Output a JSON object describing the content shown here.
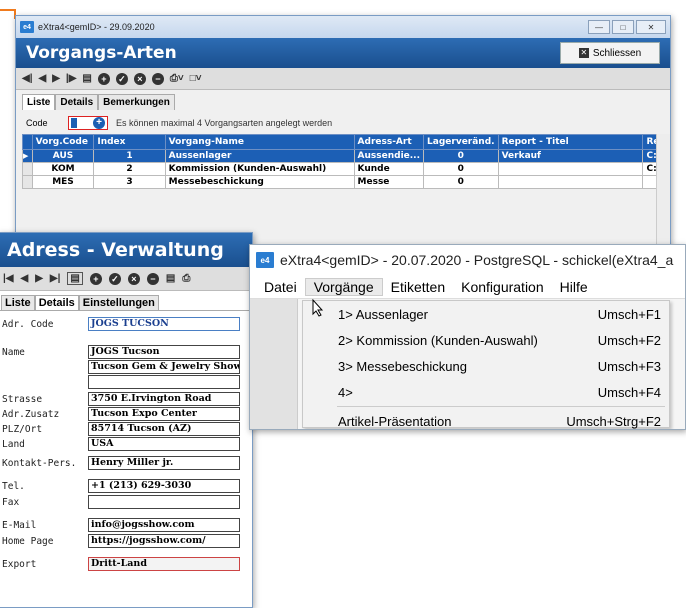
{
  "win1": {
    "title": "eXtra4<gemID> - 29.09.2020",
    "heading": "Vorgangs-Arten",
    "close_label": "Schliessen",
    "tabs": [
      "Liste",
      "Details",
      "Bemerkungen"
    ],
    "code_label": "Code",
    "hint": "Es können maximal 4 Vorgangsarten angelegt werden",
    "columns": [
      "Vorg.Code",
      "Index",
      "Vorgang-Name",
      "Adress-Art",
      "Lagerveränd.",
      "Report - Titel",
      "Rep"
    ],
    "rows": [
      [
        "AUS",
        "1",
        "Aussenlager",
        "Aussendie...",
        "0",
        "Verkauf",
        "C:\\"
      ],
      [
        "KOM",
        "2",
        "Kommission (Kunden-Auswahl)",
        "Kunde",
        "0",
        "",
        "C:\\"
      ],
      [
        "MES",
        "3",
        "Messebeschickung",
        "Messe",
        "0",
        "",
        ""
      ]
    ]
  },
  "win2": {
    "heading": "Adress - Verwaltung",
    "tabs": [
      "Liste",
      "Details",
      "Einstellungen"
    ],
    "fields": {
      "adr_code_label": "Adr. Code",
      "adr_code": "JOGS TUCSON",
      "name_label": "Name",
      "name1": "JOGS Tucson",
      "name2": "Tucson Gem & Jewelry Show",
      "strasse_label": "Strasse",
      "strasse": "3750 E.Irvington Road",
      "zusatz_label": "Adr.Zusatz",
      "zusatz": "Tucson Expo Center",
      "plz_label": "PLZ/Ort",
      "plz": "85714 Tucson (AZ)",
      "land_label": "Land",
      "land": "USA",
      "kontakt_label": "Kontakt-Pers.",
      "kontakt": "Henry Miller jr.",
      "tel_label": "Tel.",
      "tel": "+1 (213) 629-3030",
      "fax_label": "Fax",
      "fax": "",
      "email_label": "E-Mail",
      "email": "info@jogsshow.com",
      "home_label": "Home Page",
      "home": "https://jogsshow.com/",
      "export_label": "Export",
      "export": "Dritt-Land"
    }
  },
  "win3": {
    "title": "eXtra4<gemID> - 20.07.2020 - PostgreSQL - schickel(eXtra4_a",
    "menu": [
      "Datei",
      "Vorgänge",
      "Etiketten",
      "Konfiguration",
      "Hilfe"
    ],
    "dropdown": [
      {
        "label": "1> Aussenlager",
        "shortcut": "Umsch+F1"
      },
      {
        "label": "2> Kommission (Kunden-Auswahl)",
        "shortcut": "Umsch+F2"
      },
      {
        "label": "3> Messebeschickung",
        "shortcut": "Umsch+F3"
      },
      {
        "label": "4>",
        "shortcut": "Umsch+F4"
      },
      {
        "label": "Artikel-Präsentation",
        "shortcut": "Umsch+Strg+F2"
      }
    ]
  },
  "colors": {
    "accent": "#1c5fb5",
    "highlight": "#f07b1e"
  }
}
